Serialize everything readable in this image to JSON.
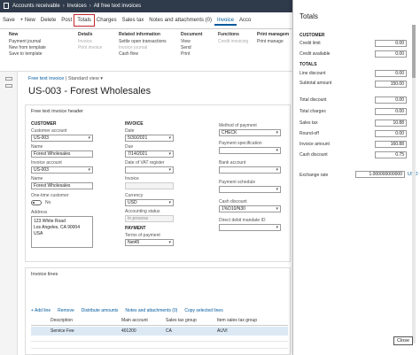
{
  "topbar": {
    "crumbs": [
      "Accounts receivable",
      "Invoices",
      "All free text invoices"
    ]
  },
  "ribbon": {
    "items": [
      "Save",
      "+ New",
      "Delete",
      "Post",
      "Totals",
      "Charges",
      "Sales tax",
      "Notes and attachments (0)",
      "Invoice",
      "Acco"
    ]
  },
  "menus": {
    "new": {
      "header": "New",
      "items": [
        "Payment journal",
        "New from template",
        "Save to template"
      ]
    },
    "details": {
      "header": "Details",
      "items": [
        "Invoice",
        "Print invoice"
      ]
    },
    "related": {
      "header": "Related information",
      "items": [
        "Settle open transactions",
        "Invoice journal",
        "Cash flow"
      ]
    },
    "document": {
      "header": "Document",
      "items": [
        "View",
        "Send",
        "Print"
      ]
    },
    "functions": {
      "header": "Functions",
      "items": [
        "Credit invoicing"
      ]
    },
    "print": {
      "header": "Print managem",
      "items": [
        "Print manage"
      ]
    }
  },
  "crumb": {
    "link": "Free text invoice",
    "view": "Standard view"
  },
  "title": "US-003 - Forest Wholesales",
  "header": {
    "section": "Free text invoice header",
    "customer": {
      "group": "CUSTOMER",
      "customer_account_label": "Customer account",
      "customer_account": "US-003",
      "name_label": "Name",
      "name": "Forest Wholesales",
      "invoice_account_label": "Invoice account",
      "invoice_account": "US-003",
      "name2_label": "Name",
      "name2": "Forest Wholesales",
      "onetime_label": "One-time customer",
      "onetime_value": "No",
      "address_label": "Address",
      "address_lines": [
        "123 White Road",
        "Los Angeles, CA 90004",
        "USA"
      ]
    },
    "invoice": {
      "group": "INVOICE",
      "date_label": "Date",
      "date": "5/30/2021",
      "due_label": "Due",
      "due": "7/14/2021",
      "vat_label": "Date of VAT register",
      "vat": "",
      "invoice_label": "Invoice",
      "invoice": "",
      "currency_label": "Currency",
      "currency": "USD",
      "acct_status_label": "Accounting status",
      "acct_status": "In process",
      "payment_group": "PAYMENT",
      "terms_label": "Terms of payment",
      "terms": "Net45"
    },
    "method": {
      "method_label": "Method of payment",
      "method": "CHECK",
      "spec_label": "Payment specification",
      "spec": "",
      "bank_label": "Bank account",
      "bank": "",
      "schedule_label": "Payment schedule",
      "schedule": "",
      "cash_label": "Cash discount",
      "cash": "1%D10/N30",
      "mandate_label": "Direct debit mandate ID",
      "mandate": ""
    }
  },
  "lines": {
    "section": "Invoice lines",
    "toolbar": [
      "+ Add line",
      "Remove",
      "Distribute amounts",
      "Notes and attachments (0)",
      "Copy selected lines"
    ],
    "columns": [
      "Description",
      "Main account",
      "Sales tax group",
      "Item sales tax group"
    ],
    "rows": [
      {
        "description": "Service Fee",
        "account": "401200",
        "tax_group": "CA",
        "item_tax_group": "AUVI"
      }
    ]
  },
  "totals": {
    "title": "Totals",
    "customer_section": "CUSTOMER",
    "credit_limit_label": "Credit limit",
    "credit_limit": "0.00",
    "credit_available_label": "Credit available",
    "credit_available": "0.00",
    "totals_section": "TOTALS",
    "line_discount_label": "Line discount",
    "line_discount": "0.00",
    "subtotal_label": "Subtotal amount",
    "subtotal": "150.00",
    "total_discount_label": "Total discount",
    "total_discount": "0.00",
    "total_charges_label": "Total charges",
    "total_charges": "0.00",
    "sales_tax_label": "Sales tax",
    "sales_tax": "10.88",
    "round_off_label": "Round-off",
    "round_off": "0.00",
    "invoice_amount_label": "Invoice amount",
    "invoice_amount": "160.88",
    "cash_discount_label": "Cash discount",
    "cash_discount": "0.75",
    "exchange_rate_label": "Exchange rate",
    "exchange_rate": "1.000000000000",
    "currency": "USD",
    "close_label": "Close"
  },
  "colors": {
    "topbar": "#2f3a4a",
    "accent": "#005a9e",
    "highlight": "#c0262d",
    "selected_row": "#dce9f5"
  }
}
